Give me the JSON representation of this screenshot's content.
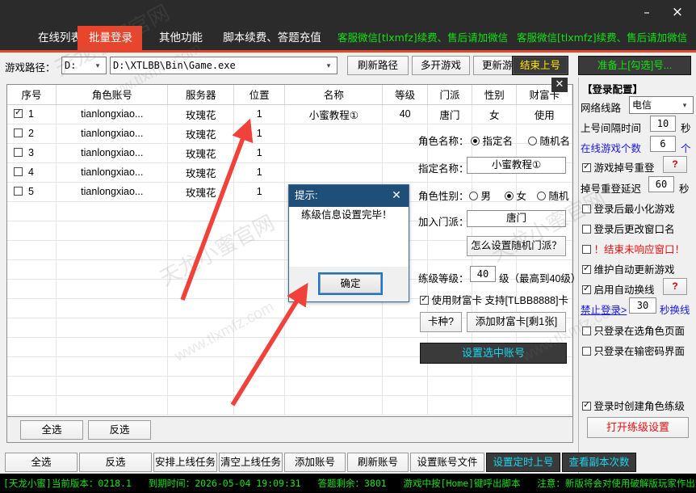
{
  "window": {
    "minimize_label": "–",
    "close_label": "×"
  },
  "tabs": [
    {
      "label": "在线列表",
      "active": false
    },
    {
      "label": "批量登录",
      "active": true
    },
    {
      "label": "其他功能",
      "active": false
    },
    {
      "label": "脚本续费、答题充值",
      "active": false
    }
  ],
  "promo": {
    "left": "客服微信[tlxmfz]续费、售后请加微信",
    "right": "客服微信[tlxmfz]续费、售后请加微信"
  },
  "toolbar": {
    "path_label": "游戏路径：",
    "drive_value": "D:",
    "path_value": "D:\\XTLBB\\Bin\\Game.exe",
    "refresh_path": "刷新路径",
    "multi_open": "多开游戏",
    "update_game": "更新游戏",
    "end_login": "结束上号",
    "ready_login": "准备上[勾选]号..."
  },
  "table": {
    "close_label": "✕",
    "columns": [
      "序号",
      "角色账号",
      "服务器",
      "位置",
      "名称",
      "等级",
      "门派",
      "性别",
      "财富卡"
    ],
    "rows": [
      {
        "checked": true,
        "no": "1",
        "account": "tianlongxiao...",
        "server": "玫瑰花",
        "pos": "1",
        "name": "小蜜教程①",
        "level": "40",
        "sect": "唐门",
        "gender": "女",
        "card": "使用"
      },
      {
        "checked": false,
        "no": "2",
        "account": "tianlongxiao...",
        "server": "玫瑰花",
        "pos": "1",
        "name": "",
        "level": "",
        "sect": "",
        "gender": "",
        "card": ""
      },
      {
        "checked": false,
        "no": "3",
        "account": "tianlongxiao...",
        "server": "玫瑰花",
        "pos": "1",
        "name": "",
        "level": "",
        "sect": "",
        "gender": "",
        "card": ""
      },
      {
        "checked": false,
        "no": "4",
        "account": "tianlongxiao...",
        "server": "玫瑰花",
        "pos": "1",
        "name": "",
        "level": "",
        "sect": "",
        "gender": "",
        "card": ""
      },
      {
        "checked": false,
        "no": "5",
        "account": "tianlongxiao...",
        "server": "玫瑰花",
        "pos": "1",
        "name": "",
        "level": "",
        "sect": "",
        "gender": "",
        "card": ""
      }
    ],
    "inner_select_all": "全选",
    "inner_invert": "反选"
  },
  "role": {
    "name_label": "角色名称：",
    "name_fixed": "指定名",
    "name_random": "随机名",
    "name_mode": "fixed",
    "fixed_label": "指定名称：",
    "fixed_value": "小蜜教程①",
    "gender_label": "角色性别：",
    "gender_male": "男",
    "gender_female": "女",
    "gender_random": "随机",
    "gender_mode": "female",
    "sect_label": "加入门派：",
    "sect_value": "唐门",
    "random_sect_help": "怎么设置随机门派？",
    "level_label": "练级等级：",
    "level_value": "40",
    "level_suffix": "级（最高到40级）",
    "use_card_label": "使用财富卡  支持[TLBB8888]卡",
    "use_card_checked": true,
    "card_type_btn": "卡种?",
    "add_card_btn": "添加财富卡[剩1张]",
    "apply_btn": "设置选中账号"
  },
  "config": {
    "title": "【登录配置】",
    "line_label": "网络线路",
    "line_value": "电信",
    "interval_label": "上号间隔时间",
    "interval_value": "10",
    "interval_unit": "秒",
    "online_count_label": "在线游戏个数",
    "online_count_value": "6",
    "online_count_unit": "个",
    "relogin_label": "游戏掉号重登",
    "relogin_checked": true,
    "relogin_help": "?",
    "relogin_delay_label": "掉号重登延迟",
    "relogin_delay_value": "60",
    "relogin_delay_unit": "秒",
    "minimize_label": "登录后最小化游戏",
    "minimize_checked": false,
    "rename_label": "登录后更改窗口名",
    "rename_checked": false,
    "kill_label": "！结束未响应窗口！",
    "kill_checked": false,
    "autoupdate_label": "维护自动更新游戏",
    "autoupdate_checked": true,
    "autoswitch_label": "启用自动换线",
    "autoswitch_checked": true,
    "autoswitch_help": "?",
    "forbid_label": "禁止登录>",
    "forbid_value": "30",
    "forbid_unit": "秒换线",
    "only_role_page_label": "只登录在选角色页面",
    "only_role_page_checked": false,
    "only_pwd_page_label": "只登录在输密码界面",
    "only_pwd_page_checked": false,
    "create_role_label": "登录时创建角色练级",
    "create_role_checked": true,
    "open_level_btn": "打开练级设置"
  },
  "bottombar": [
    {
      "label": "全选",
      "style": "plain"
    },
    {
      "label": "反选",
      "style": "plain"
    },
    {
      "label": "安排上线任务",
      "style": "plain"
    },
    {
      "label": "清空上线任务",
      "style": "plain"
    },
    {
      "label": "添加账号",
      "style": "plain"
    },
    {
      "label": "刷新账号",
      "style": "plain"
    },
    {
      "label": "设置账号文件",
      "style": "plain"
    },
    {
      "label": "设置定时上号",
      "style": "darkcyan"
    },
    {
      "label": "查看副本次数",
      "style": "darkcyan"
    }
  ],
  "status": {
    "version_label": "[天龙小蜜]当前版本：",
    "version_value": "0218.1",
    "expire_label": "到期时间：",
    "expire_value": "2026-05-04 19:09:31",
    "quiz_label": "答题剩余：",
    "quiz_value": "3801",
    "hotkey_text": "游戏中按[Home]键呼出脚本",
    "warning_text": "注意：新版将会对使用破解版玩家作出惩罚！"
  },
  "dialog": {
    "title": "提示:",
    "close": "✕",
    "message": "练级信息设置完毕！",
    "ok": "确定"
  },
  "watermarks": [
    "天龙小蜜官网",
    "www.tlxmfz.com",
    "天龙小蜜官网",
    "www.tlxmfz.com",
    "天龙小蜜官网",
    "www.tlxmfz.com"
  ],
  "colors": {
    "accent_red": "#e8452c",
    "green": "#12e512",
    "yellow": "#ffe800",
    "cyan": "#1ad6f0",
    "blue": "#1616e8",
    "dark": "#2b2b2b"
  }
}
